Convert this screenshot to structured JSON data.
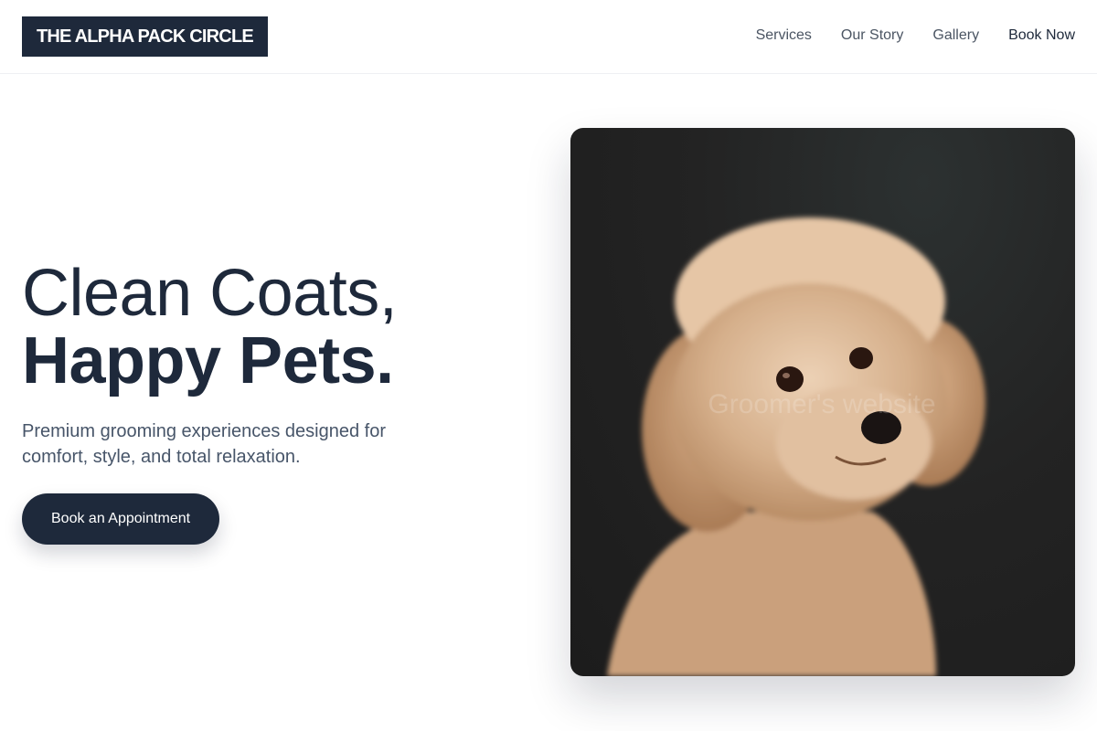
{
  "brand": {
    "name": "THE ALPHA PACK CIRCLE"
  },
  "nav": {
    "items": [
      {
        "label": "Services"
      },
      {
        "label": "Our Story"
      },
      {
        "label": "Gallery"
      },
      {
        "label": "Book Now"
      }
    ]
  },
  "hero": {
    "headline_line1": "Clean Coats,",
    "headline_line2": "Happy Pets.",
    "subtitle": "Premium grooming experiences designed for comfort, style, and total relaxation.",
    "cta_label": "Book an Appointment"
  },
  "image": {
    "watermark": "Groomer's website"
  },
  "colors": {
    "brand_navy": "#1e293b",
    "nav_text": "#4b5563",
    "subtitle_text": "#475569",
    "photo_background": "#232323"
  }
}
